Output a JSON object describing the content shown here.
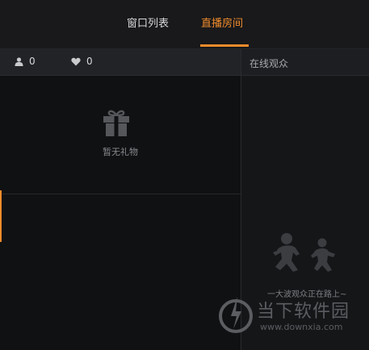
{
  "tabs": [
    {
      "label": "窗口列表",
      "active": false
    },
    {
      "label": "直播房间",
      "active": true
    }
  ],
  "stats": {
    "viewers": {
      "icon": "user-icon",
      "value": "0"
    },
    "likes": {
      "icon": "heart-icon",
      "value": "0"
    }
  },
  "gifts": {
    "icon": "gift-icon",
    "empty_text": "暂无礼物"
  },
  "audience": {
    "header": "在线观众",
    "illustration": "people-running-icon",
    "empty_text": "一大波观众正在路上~"
  },
  "watermark": {
    "name": "当下软件园",
    "url": "www.downxia.com"
  },
  "colors": {
    "accent": "#f08b2b",
    "background": "#111214",
    "panel": "#222326"
  }
}
